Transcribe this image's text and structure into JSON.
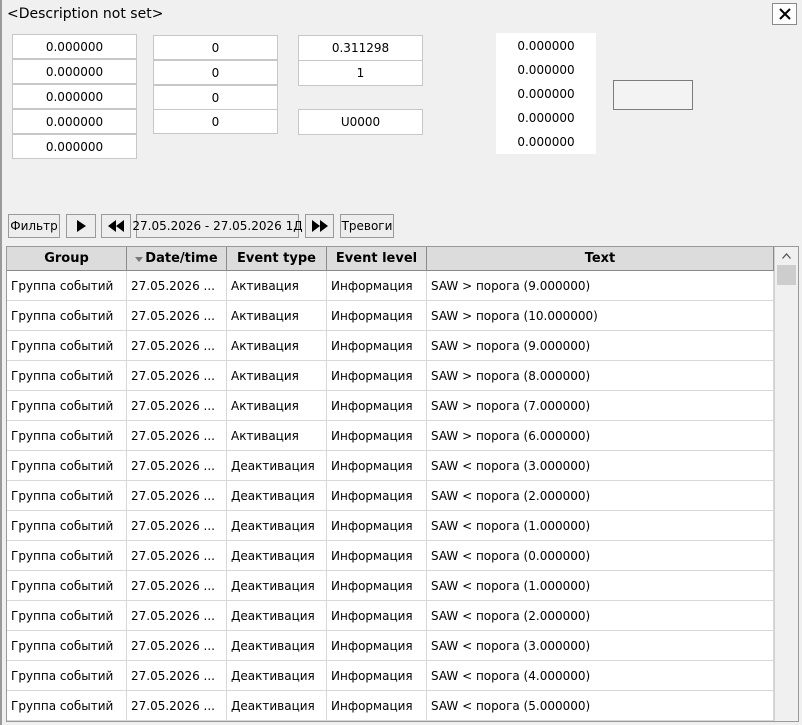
{
  "title": "<Description not set>",
  "close_icon": "close-icon",
  "col1": [
    "0.000000",
    "0.000000",
    "0.000000",
    "0.000000",
    "0.000000"
  ],
  "col2": [
    "0",
    "0",
    "0",
    "0"
  ],
  "col3": {
    "value1": "0.311298",
    "value2": "1",
    "value3": "U0000"
  },
  "col4": [
    "0.000000",
    "0.000000",
    "0.000000",
    "0.000000",
    "0.000000"
  ],
  "toolbar": {
    "filter_label": "Фильтр",
    "play_icon": "play-icon",
    "rewind_icon": "rewind-icon",
    "date_range": "27.05.2026 - 27.05.2026 1Д",
    "forward_icon": "fast-forward-icon",
    "alarms_label": "Тревоги"
  },
  "table": {
    "columns": [
      "Group",
      "Date/time",
      "Event type",
      "Event level",
      "Text"
    ],
    "sort_icon": "sort-down-icon",
    "rows": [
      [
        "Группа событий",
        "27.05.2026 ...",
        "Активация",
        "Информация",
        "SAW > порога (9.000000)"
      ],
      [
        "Группа событий",
        "27.05.2026 ...",
        "Активация",
        "Информация",
        "SAW > порога (10.000000)"
      ],
      [
        "Группа событий",
        "27.05.2026 ...",
        "Активация",
        "Информация",
        "SAW > порога (9.000000)"
      ],
      [
        "Группа событий",
        "27.05.2026 ...",
        "Активация",
        "Информация",
        "SAW > порога (8.000000)"
      ],
      [
        "Группа событий",
        "27.05.2026 ...",
        "Активация",
        "Информация",
        "SAW > порога (7.000000)"
      ],
      [
        "Группа событий",
        "27.05.2026 ...",
        "Активация",
        "Информация",
        "SAW > порога (6.000000)"
      ],
      [
        "Группа событий",
        "27.05.2026 ...",
        "Деактивация",
        "Информация",
        "SAW < порога (3.000000)"
      ],
      [
        "Группа событий",
        "27.05.2026 ...",
        "Деактивация",
        "Информация",
        "SAW < порога (2.000000)"
      ],
      [
        "Группа событий",
        "27.05.2026 ...",
        "Деактивация",
        "Информация",
        "SAW < порога (1.000000)"
      ],
      [
        "Группа событий",
        "27.05.2026 ...",
        "Деактивация",
        "Информация",
        "SAW < порога (0.000000)"
      ],
      [
        "Группа событий",
        "27.05.2026 ...",
        "Деактивация",
        "Информация",
        "SAW < порога (1.000000)"
      ],
      [
        "Группа событий",
        "27.05.2026 ...",
        "Деактивация",
        "Информация",
        "SAW < порога (2.000000)"
      ],
      [
        "Группа событий",
        "27.05.2026 ...",
        "Деактивация",
        "Информация",
        "SAW < порога (3.000000)"
      ],
      [
        "Группа событий",
        "27.05.2026 ...",
        "Деактивация",
        "Информация",
        "SAW < порога (4.000000)"
      ],
      [
        "Группа событий",
        "27.05.2026 ...",
        "Деактивация",
        "Информация",
        "SAW < порога (5.000000)"
      ]
    ]
  }
}
